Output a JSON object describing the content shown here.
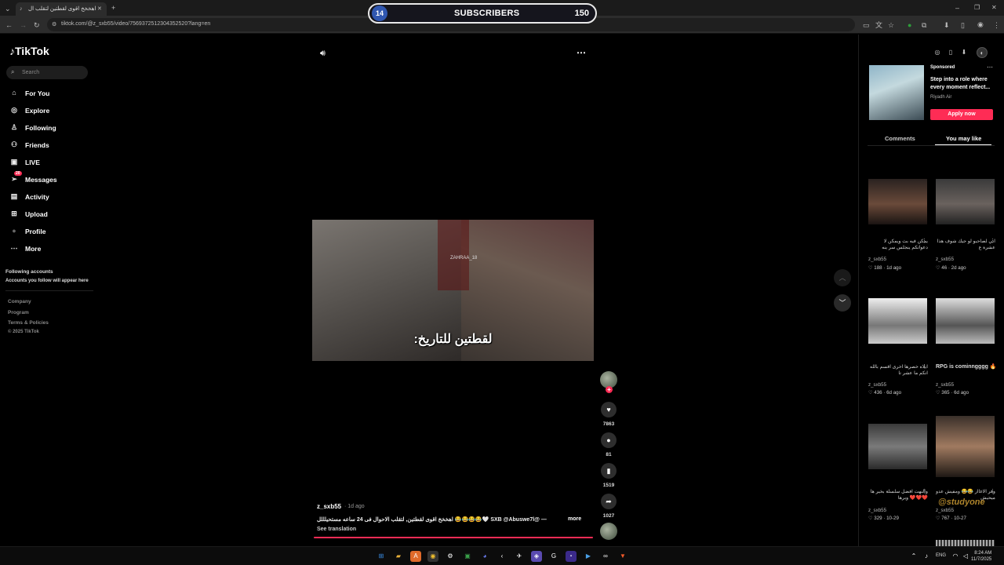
{
  "browser": {
    "tab_title": "اهخخخ اقوى لقطتين لتقلب ال",
    "url": "tiktok.com/@z_sxb55/video/7569372512304352520?lang=en"
  },
  "overlay": {
    "count_left": "14",
    "label": "SUBSCRIBERS",
    "count_right": "150"
  },
  "sidebar": {
    "logo": "TikTok",
    "search_placeholder": "Search",
    "items": [
      {
        "label": "For You",
        "icon": "home-icon"
      },
      {
        "label": "Explore",
        "icon": "compass-icon"
      },
      {
        "label": "Following",
        "icon": "user-follow-icon"
      },
      {
        "label": "Friends",
        "icon": "friends-icon"
      },
      {
        "label": "LIVE",
        "icon": "live-icon"
      },
      {
        "label": "Messages",
        "icon": "send-icon",
        "badge": "20"
      },
      {
        "label": "Activity",
        "icon": "activity-icon"
      },
      {
        "label": "Upload",
        "icon": "upload-icon"
      },
      {
        "label": "Profile",
        "icon": "avatar"
      },
      {
        "label": "More",
        "icon": "more-dots-icon"
      }
    ],
    "following_title": "Following accounts",
    "following_sub": "Accounts you follow will appear here",
    "footer": [
      "Company",
      "Program",
      "Terms & Policies",
      "© 2025 TikTok"
    ]
  },
  "video": {
    "caption_overlay": "لقطتين للتاريخ:",
    "watermark": "ZAHRAA_18",
    "author": "z_sxb55",
    "posted": "· 1d ago",
    "description": "— @SXB @Abuswe7l 🤍😂😂😂😂 اهخخخ اقوى لقطتين, لتقلب الاحوال فى 24 ساعه مستحيلللل",
    "more": "more",
    "see_translation": "See translation",
    "likes": "7863",
    "comments": "81",
    "saves": "1519",
    "shares": "1027"
  },
  "right_panel": {
    "sponsored": "Sponsored",
    "ad_title": "Step into a role where every moment reflect...",
    "ad_brand": "Riyadh Air",
    "ad_button": "Apply now",
    "tabs": [
      "Comments",
      "You may like"
    ],
    "videos": [
      {
        "caption": "يمكن فيه بث ويمكن لا دعواتكم ينجلس سر ينه",
        "author": "z_sxb55",
        "likes": "188",
        "age": "1d ago"
      },
      {
        "caption": "اني لصاحبو لو جيك شوف هذا عشرة ع",
        "author": "z_sxb55",
        "likes": "46",
        "age": "2d ago"
      },
      {
        "caption": "ايلاه خصرها اخرى اقسم بالله انكم ما عشر تا",
        "author": "z_sxb55",
        "likes": "436",
        "age": "6d ago"
      },
      {
        "caption": "RPG is cominngggg 🔥",
        "author": "z_sxb55",
        "likes": "365",
        "age": "6d ago"
      },
      {
        "caption": "والنهت افضل سلسلة بخير ها ❤️❤️❤️ وبرها",
        "author": "z_sxb55",
        "likes": "329",
        "age": "10-29"
      },
      {
        "caption": "وفر الاغاار 😂😂 ومفيش عدو ميحيش",
        "author": "z_sxb55",
        "likes": "767",
        "age": "10-27"
      }
    ]
  },
  "taskbar": {
    "lang": "ENG",
    "time": "8:24 AM",
    "date": "11/7/2025",
    "watermark": "@studyone"
  }
}
